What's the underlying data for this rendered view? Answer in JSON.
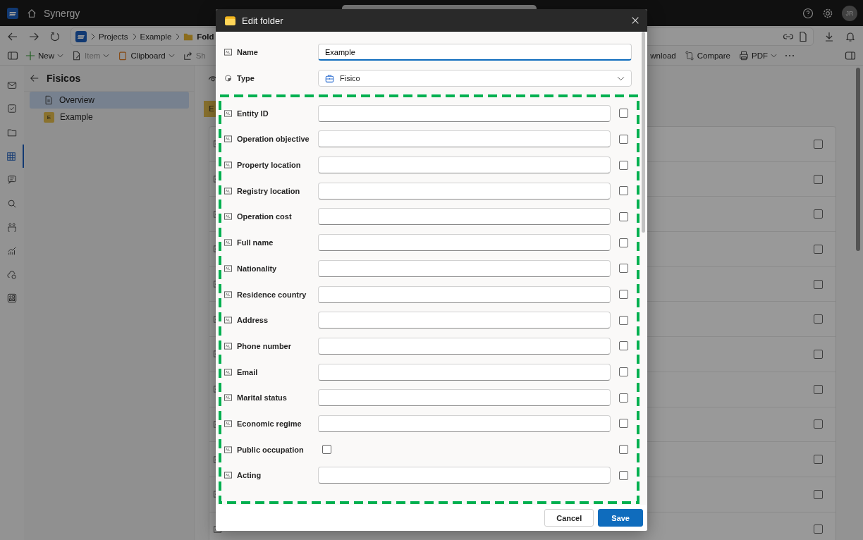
{
  "app": {
    "title": "Synergy",
    "avatar": "JR"
  },
  "breadcrumb": [
    "Projects",
    "Example",
    "Fold"
  ],
  "toolbar_left": [
    {
      "label": "New",
      "kind": "add",
      "dropdown": true,
      "disabled": false
    },
    {
      "label": "Item",
      "kind": "item",
      "dropdown": true,
      "disabled": true
    },
    {
      "label": "Clipboard",
      "kind": "clipboard",
      "dropdown": true,
      "disabled": false
    },
    {
      "label": "Sh",
      "kind": "share",
      "dropdown": false,
      "disabled": true
    }
  ],
  "toolbar_right": [
    {
      "label": "wnload",
      "kind": "none",
      "dropdown": false,
      "disabled": false
    },
    {
      "label": "Compare",
      "kind": "compare",
      "dropdown": false,
      "disabled": false
    },
    {
      "label": "PDF",
      "kind": "pdf",
      "dropdown": true,
      "disabled": false
    }
  ],
  "rail": [
    {
      "kind": "mail",
      "selected": false
    },
    {
      "kind": "task",
      "selected": false
    },
    {
      "kind": "folder",
      "selected": false
    },
    {
      "kind": "grid",
      "selected": true
    },
    {
      "kind": "chat",
      "selected": false
    },
    {
      "kind": "search",
      "selected": false
    },
    {
      "kind": "people",
      "selected": false
    },
    {
      "kind": "chart",
      "selected": false
    },
    {
      "kind": "cloud",
      "selected": false
    },
    {
      "kind": "apps",
      "selected": false
    }
  ],
  "panel": {
    "title": "Fisicos",
    "items": [
      {
        "label": "Overview",
        "kind": "page",
        "selected": true
      },
      {
        "label": "Example",
        "kind": "entity",
        "badge": "E",
        "selected": false
      }
    ]
  },
  "main": {
    "tag": "E",
    "rows": [
      {
        "checked": false
      },
      {
        "checked": false
      },
      {
        "checked": false
      },
      {
        "checked": false
      },
      {
        "checked": false
      },
      {
        "checked": false
      },
      {
        "checked": false
      },
      {
        "checked": false
      },
      {
        "checked": false
      },
      {
        "checked": false
      },
      {
        "checked": false
      },
      {
        "checked": false
      }
    ]
  },
  "dialog": {
    "title": "Edit folder",
    "name": {
      "label": "Name",
      "value": "Example"
    },
    "type": {
      "label": "Type",
      "value": "Fisico"
    },
    "fields": [
      {
        "label": "Entity ID",
        "kind": "text",
        "included": false
      },
      {
        "label": "Operation objective",
        "kind": "text",
        "included": false
      },
      {
        "label": "Property location",
        "kind": "text",
        "included": false
      },
      {
        "label": "Registry location",
        "kind": "text",
        "included": false
      },
      {
        "label": "Operation cost",
        "kind": "text",
        "included": false
      },
      {
        "label": "Full name",
        "kind": "text",
        "included": false
      },
      {
        "label": "Nationality",
        "kind": "text",
        "included": false
      },
      {
        "label": "Residence country",
        "kind": "text",
        "included": false
      },
      {
        "label": "Address",
        "kind": "text",
        "included": false
      },
      {
        "label": "Phone number",
        "kind": "text",
        "included": false
      },
      {
        "label": "Email",
        "kind": "text",
        "included": false
      },
      {
        "label": "Marital status",
        "kind": "text",
        "included": false
      },
      {
        "label": "Economic regime",
        "kind": "text",
        "included": false
      },
      {
        "label": "Public occupation",
        "kind": "checkbox",
        "checked": false,
        "included": false
      },
      {
        "label": "Acting",
        "kind": "text",
        "included": false
      }
    ],
    "buttons": [
      {
        "label": "Cancel",
        "kind": "secondary"
      },
      {
        "label": "Save",
        "kind": "primary"
      }
    ]
  },
  "annotation": {
    "kind": "dashed-frame"
  }
}
